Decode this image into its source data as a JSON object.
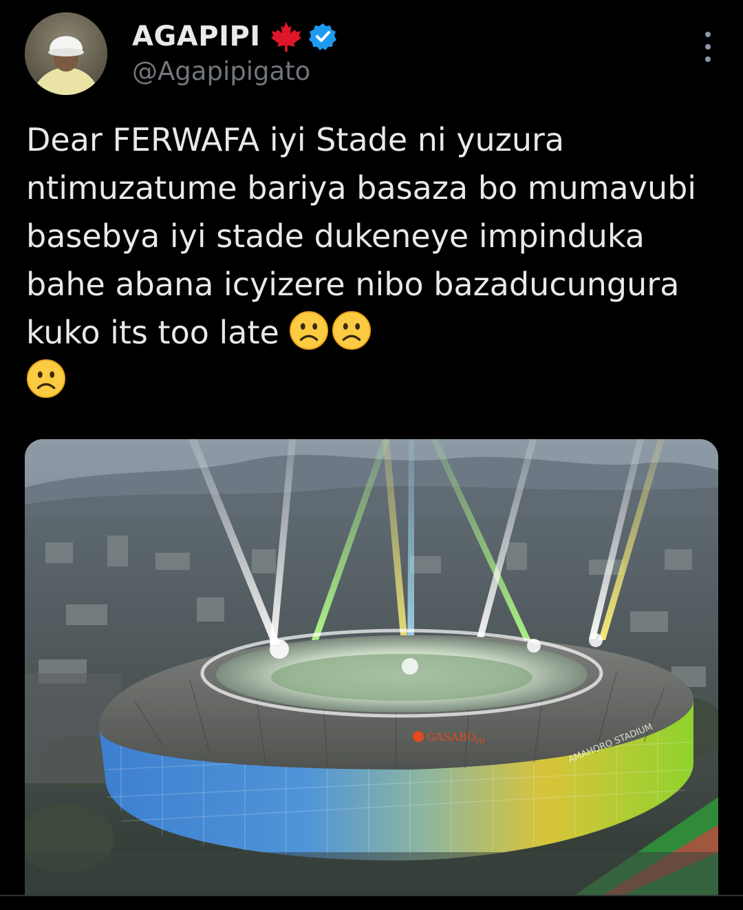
{
  "tweet": {
    "author": {
      "display_name": "AGAPIPI",
      "handle": "@Agapipigato",
      "badges": [
        "maple-leaf-icon",
        "verified-badge-icon"
      ],
      "avatar_icon": "avatar-person-white-cap"
    },
    "more_icon": "more-vertical-icon",
    "text": "Dear FERWAFA iyi Stade ni yuzura ntimuzatume bariya basaza bo mumavubi basebya iyi stade dukeneye impinduka bahe abana icyizere nibo bazaducungura  kuko its too late",
    "emojis": [
      "☹️",
      "☹️",
      "☹️"
    ],
    "media": {
      "logo_text": "GASABO",
      "logo_sub": "3D",
      "facade_text": "AMAHORO STADIUM"
    }
  },
  "colors": {
    "background": "#000000",
    "text_primary": "#e7e9ea",
    "text_secondary": "#71767b",
    "verified_blue": "#1d9bf0",
    "maple_red": "#e0162b"
  }
}
